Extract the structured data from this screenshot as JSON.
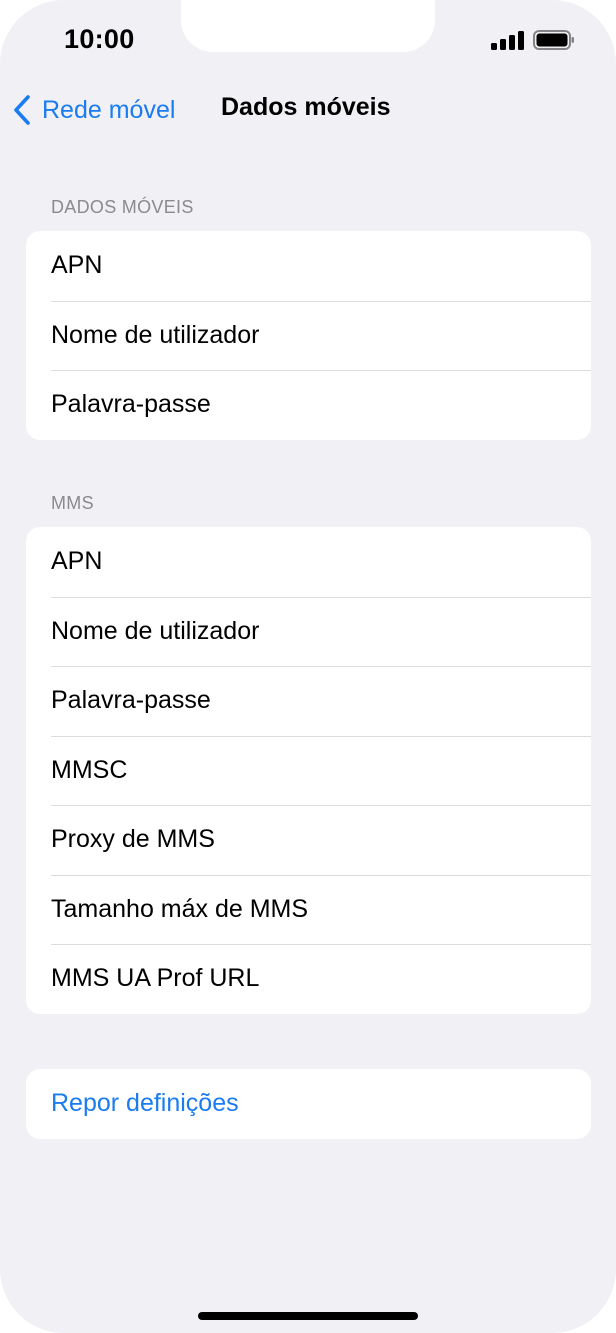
{
  "status_bar": {
    "time": "10:00"
  },
  "nav": {
    "back_label": "Rede móvel",
    "title": "Dados móveis"
  },
  "sections": {
    "mobile_data": {
      "header": "DADOS MÓVEIS",
      "rows": [
        "APN",
        "Nome de utilizador",
        "Palavra-passe"
      ]
    },
    "mms": {
      "header": "MMS",
      "rows": [
        "APN",
        "Nome de utilizador",
        "Palavra-passe",
        "MMSC",
        "Proxy de MMS",
        "Tamanho máx de MMS",
        "MMS UA Prof URL"
      ]
    },
    "reset": {
      "label": "Repor definições"
    }
  },
  "colors": {
    "accent": "#1a7cf0",
    "background": "#f0f0f5",
    "section_header": "#8a8a8f"
  },
  "icons": {
    "back": "chevron-left-icon",
    "signal": "cellular-signal-icon",
    "battery": "battery-icon"
  }
}
